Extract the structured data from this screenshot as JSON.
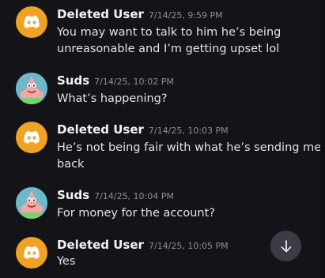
{
  "messages": [
    {
      "author": "Deleted User",
      "avatar_icon": "discord-logo-icon",
      "avatar_color": "#f0a224",
      "timestamp": "7/14/25, 9:59 PM",
      "lines": [
        "You may want to talk to him he’s being",
        "unreasonable and I’m getting upset lol"
      ]
    },
    {
      "author": "Suds",
      "avatar_icon": "patrick-star-avatar-icon",
      "avatar_color": "#6fb8c9",
      "timestamp": "7/14/25, 10:02 PM",
      "lines": [
        "What’s happening?"
      ]
    },
    {
      "author": "Deleted User",
      "avatar_icon": "discord-logo-icon",
      "avatar_color": "#f0a224",
      "timestamp": "7/14/25, 10:03 PM",
      "lines": [
        "He’s not being fair with what he’s sending me",
        "back"
      ]
    },
    {
      "author": "Suds",
      "avatar_icon": "patrick-star-avatar-icon",
      "avatar_color": "#6fb8c9",
      "timestamp": "7/14/25, 10:04 PM",
      "lines": [
        "For money for the account?"
      ]
    },
    {
      "author": "Deleted User",
      "avatar_icon": "discord-logo-icon",
      "avatar_color": "#f0a224",
      "timestamp": "7/14/25, 10:05 PM",
      "lines": [
        "Yes"
      ]
    }
  ],
  "scroll_button": {
    "icon": "arrow-down-icon"
  },
  "colors": {
    "background": "#131318",
    "username": "#f2f3f5",
    "timestamp": "#8d8f97",
    "message_text": "#e2e3e8",
    "scroll_button_bg": "#3b3c45"
  }
}
